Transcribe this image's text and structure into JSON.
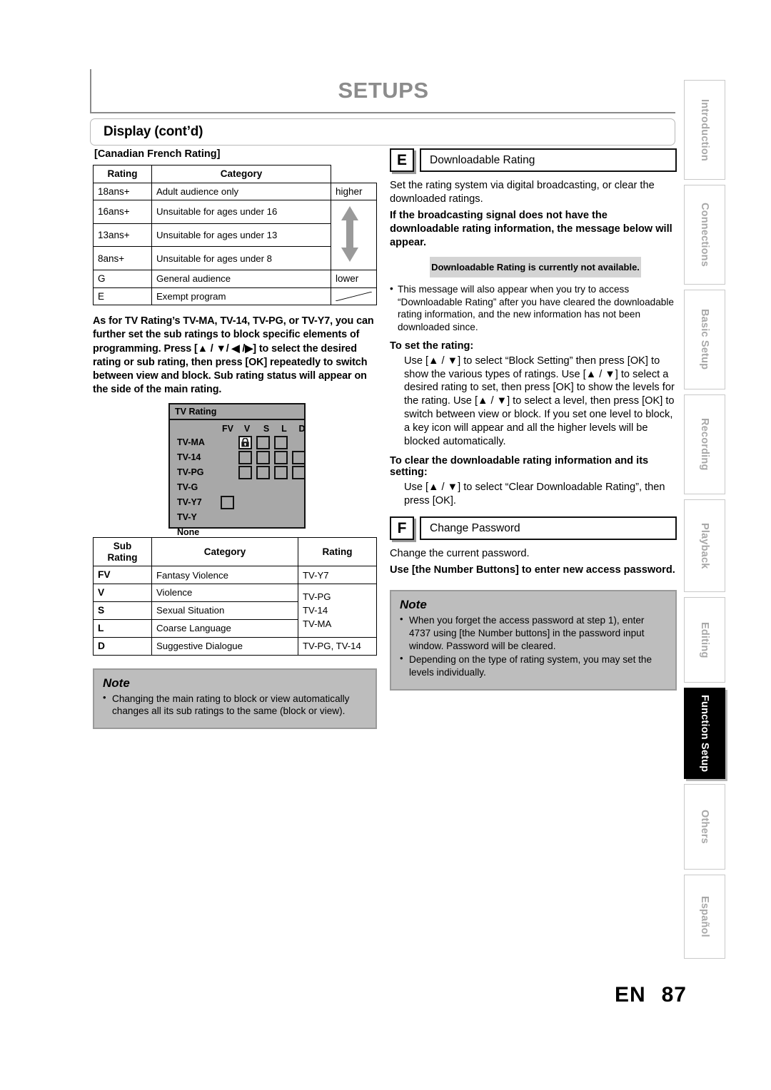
{
  "header": {
    "title": "SETUPS",
    "subtitle": "Display (cont’d)"
  },
  "left": {
    "section_heading": "[Canadian French Rating]",
    "cf_table": {
      "headers": [
        "Rating",
        "Category"
      ],
      "rows": [
        {
          "rating": "18ans+",
          "category": "Adult audience only"
        },
        {
          "rating": "16ans+",
          "category": "Unsuitable for ages under 16"
        },
        {
          "rating": "13ans+",
          "category": "Unsuitable for ages under 13"
        },
        {
          "rating": "8ans+",
          "category": "Unsuitable for ages under 8"
        },
        {
          "rating": "G",
          "category": "General audience"
        },
        {
          "rating": "E",
          "category": "Exempt program"
        }
      ],
      "arrow_top_label": "higher",
      "arrow_bottom_label": "lower"
    },
    "bold_paragraph": "As for TV Rating’s TV-MA, TV-14, TV-PG, or TV-Y7, you can further set the sub ratings to block specific elements of programming. Press [▲ / ▼/ ◀ /▶] to select the desired rating or sub rating, then press [OK] repeatedly to switch between view and block. Sub rating status will appear on the side of the main rating.",
    "osd": {
      "title": "TV Rating",
      "columns": [
        "FV",
        "V",
        "S",
        "L",
        "D"
      ],
      "rows": [
        "TV-MA",
        "TV-14",
        "TV-PG",
        "TV-G",
        "TV-Y7",
        "TV-Y",
        "None"
      ],
      "locked_cell": {
        "row": "TV-MA",
        "column": "V"
      }
    },
    "sub_table": {
      "headers": [
        "Sub Rating",
        "Category",
        "Rating"
      ],
      "rows": [
        {
          "sub": "FV",
          "category": "Fantasy Violence",
          "rating": "TV-Y7"
        },
        {
          "sub": "V",
          "category": "Violence",
          "rating": ""
        },
        {
          "sub": "S",
          "category": "Sexual Situation",
          "rating": ""
        },
        {
          "sub": "L",
          "category": "Coarse Language",
          "rating": ""
        },
        {
          "sub": "D",
          "category": "Suggestive Dialogue",
          "rating": "TV-PG, TV-14"
        }
      ],
      "merged_rating_lines": [
        "TV-PG",
        "TV-14",
        "TV-MA"
      ]
    },
    "note": {
      "title": "Note",
      "items": [
        "Changing the main rating to block or view automatically changes all its sub ratings to the same (block or view)."
      ]
    }
  },
  "right": {
    "section_e": {
      "letter": "E",
      "label": "Downloadable Rating",
      "intro": "Set the rating system via digital broadcasting, or clear the downloaded ratings.",
      "bold_intro": "If the broadcasting signal does not have the downloadable rating information, the message below will appear.",
      "message_box": "Downloadable Rating is currently not available.",
      "bullets": [
        "This message will also appear when you try to access “Downloadable Rating” after you have cleared the downloadable rating information, and the new information has not been downloaded since."
      ],
      "set_rating_heading": "To set the rating:",
      "set_rating_body": "Use [▲ / ▼] to select “Block Setting” then press [OK] to show the various types of ratings. Use [▲ / ▼] to select a desired rating to set, then press [OK] to show the levels for the rating. Use [▲ / ▼] to select a level, then press [OK] to switch between view or block. If you set one level to block, a key icon will appear and all the higher levels will be blocked automatically.",
      "clear_rating_heading": "To clear the downloadable rating information and its setting:",
      "clear_rating_body": "Use [▲ / ▼] to select “Clear Downloadable Rating”, then press [OK]."
    },
    "section_f": {
      "letter": "F",
      "label": "Change Password",
      "intro": "Change the current password.",
      "bold_intro": "Use [the Number Buttons] to enter new access password."
    },
    "note": {
      "title": "Note",
      "items": [
        "When you forget the access password at step 1), enter 4737 using [the Number buttons] in the password input window. Password will be cleared.",
        "Depending on the type of rating system, you may set the levels individually."
      ]
    }
  },
  "tabs": [
    {
      "label": "Introduction",
      "active": false
    },
    {
      "label": "Connections",
      "active": false
    },
    {
      "label": "Basic Setup",
      "active": false
    },
    {
      "label": "Recording",
      "active": false
    },
    {
      "label": "Playback",
      "active": false
    },
    {
      "label": "Editing",
      "active": false
    },
    {
      "label": "Function Setup",
      "active": true
    },
    {
      "label": "Others",
      "active": false
    },
    {
      "label": "Español",
      "active": false
    }
  ],
  "footer": {
    "language": "EN",
    "page_number": "87"
  }
}
